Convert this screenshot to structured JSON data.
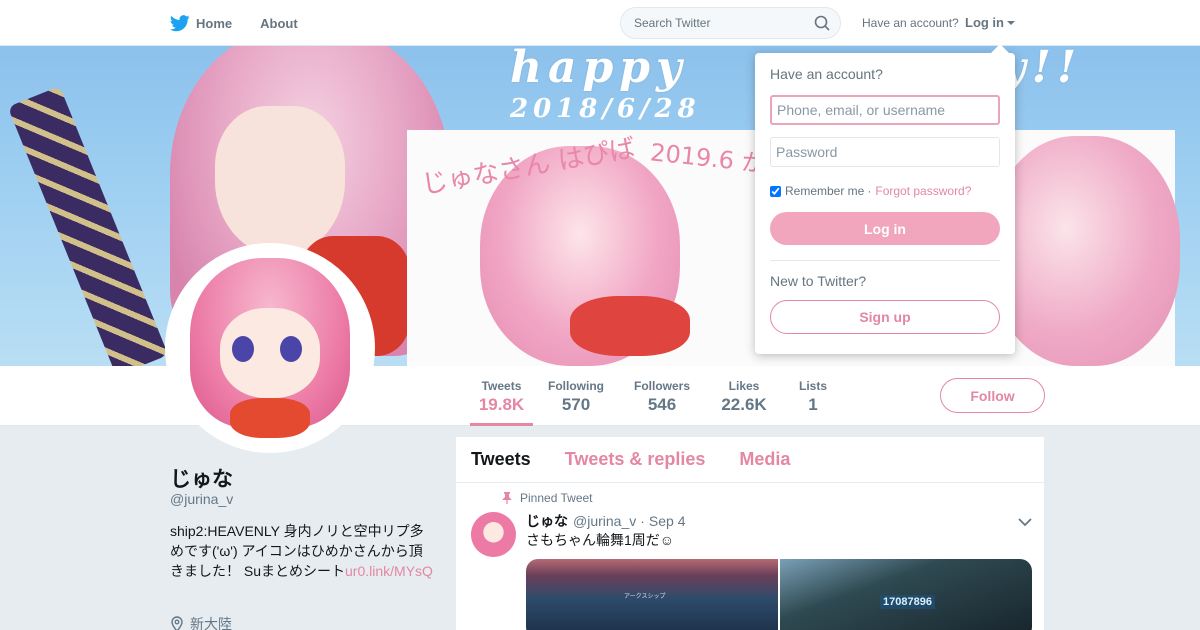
{
  "colors": {
    "accent": "#e487a3",
    "nav_text": "#66757f",
    "twitter_blue": "#1da1f2"
  },
  "nav": {
    "home_label": "Home",
    "about_label": "About",
    "search_placeholder": "Search Twitter",
    "account_question": "Have an account?",
    "login_label": "Log in"
  },
  "banner": {
    "text_line1": "happy",
    "text_line1_end": "y!!",
    "date": "2018/6/28",
    "hand_text1": "じゅなさん はぴば",
    "hand_text2": "2019.6 かわいいMA"
  },
  "stats": [
    {
      "label": "Tweets",
      "value": "19.8K"
    },
    {
      "label": "Following",
      "value": "570"
    },
    {
      "label": "Followers",
      "value": "546"
    },
    {
      "label": "Likes",
      "value": "22.6K"
    },
    {
      "label": "Lists",
      "value": "1"
    }
  ],
  "follow_label": "Follow",
  "profile": {
    "name": "じゅな",
    "handle": "@jurina_v",
    "bio": "ship2:HEAVENLY 身内ノリと空中リプ多めです('ω') アイコンはひめかさんから頂きました！ Suまとめシート",
    "bio_link": "ur0.link/MYsQ",
    "location": "新大陸"
  },
  "timeline": {
    "tabs": [
      "Tweets",
      "Tweets & replies",
      "Media"
    ],
    "pinned_label": "Pinned Tweet",
    "tweet": {
      "name": "じゅな",
      "handle": "@jurina_v",
      "date": "Sep 4",
      "text": "さもちゃん輪舞1周だ☺",
      "media_label": "アークスシップ",
      "media_number": "17087896"
    }
  },
  "login_dropdown": {
    "question": "Have an account?",
    "username_placeholder": "Phone, email, or username",
    "password_placeholder": "Password",
    "remember_label": "Remember me",
    "forgot_label": "Forgot password?",
    "login_button": "Log in",
    "new_question": "New to Twitter?",
    "signup_button": "Sign up"
  }
}
